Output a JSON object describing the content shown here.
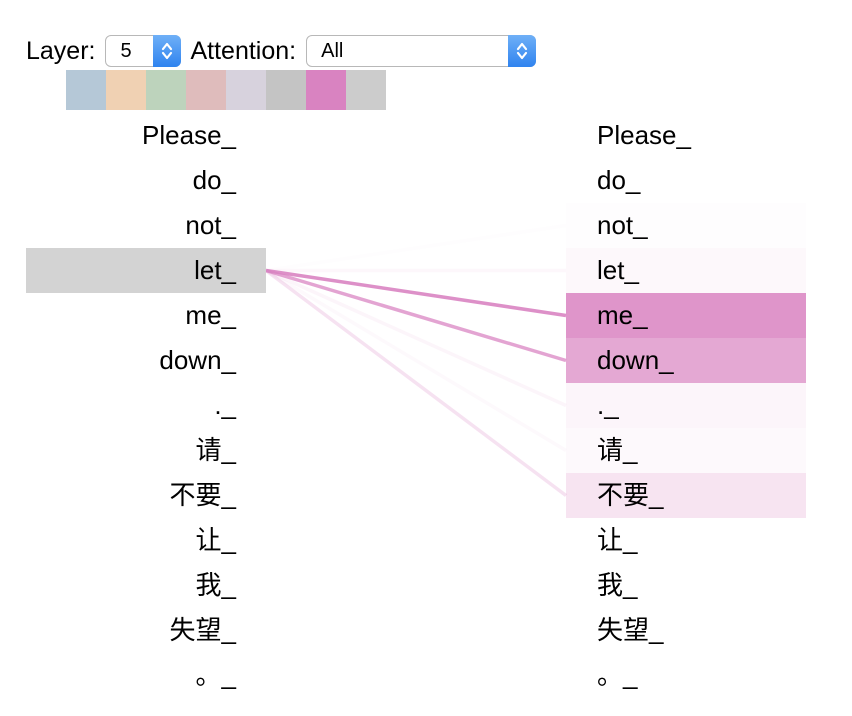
{
  "controls": {
    "layer_label": "Layer:",
    "layer_value": "5",
    "attention_label": "Attention:",
    "attention_value": "All"
  },
  "head_colors": [
    "#b5c8d7",
    "#f0d1b3",
    "#bdd3bc",
    "#dfbcbc",
    "#d7d2dd",
    "#c4c4c4",
    "#d983c1",
    "#cccccc"
  ],
  "accent_color": "#d983c1",
  "tokens": [
    "Please_",
    "do_",
    "not_",
    "let_",
    "me_",
    "down_",
    "._",
    "请_",
    "不要_",
    "让_",
    "我_",
    "失望_",
    "。_"
  ],
  "selected_index": 3,
  "attention_weights": [
    0.0,
    0.0,
    0.02,
    0.06,
    0.85,
    0.7,
    0.08,
    0.05,
    0.22,
    0.0,
    0.0,
    0.0,
    0.0
  ]
}
